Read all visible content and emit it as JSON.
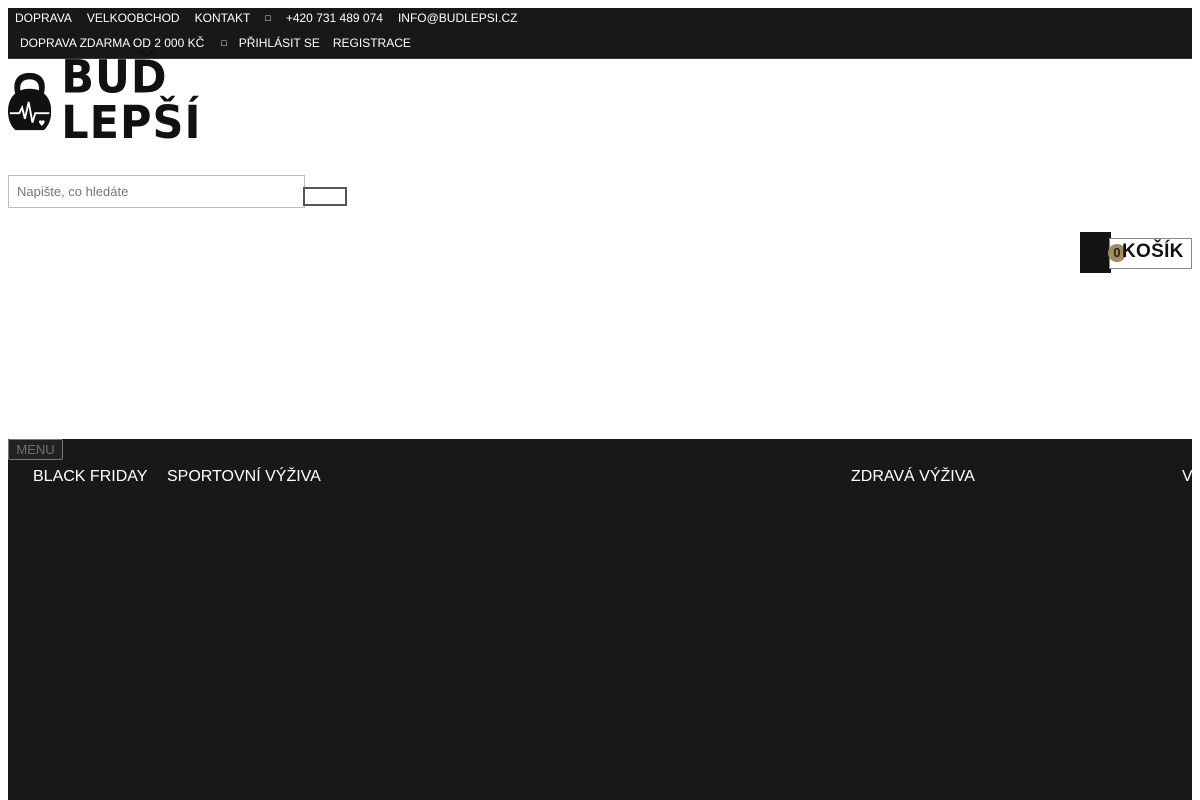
{
  "topbar": {
    "links": [
      "DOPRAVA",
      "VELKOOBCHOD",
      "KONTAKT"
    ],
    "phone_icon": "phone-icon",
    "phone": "+420 731 489 074",
    "email": "INFO@BUDLEPSI.CZ",
    "shipping_note": "DOPRAVA ZDARMA OD 2 000 KČ",
    "user_icon": "user-icon",
    "login": "PŘIHLÁSIT SE",
    "register": "REGISTRACE"
  },
  "logo": {
    "icon": "kettlebell-heartbeat-icon",
    "text": "BUĎ LEPŠÍ"
  },
  "search": {
    "placeholder": "Napište, co hledáte",
    "value": ""
  },
  "cart": {
    "count": "0",
    "label": "KOŠÍK"
  },
  "nav": {
    "menu_label": "MENU",
    "items": [
      "BLACK FRIDAY",
      "SPORTOVNÍ VÝŽIVA",
      "ZDRAVÁ VÝŽIVA",
      "V"
    ]
  },
  "colors": {
    "dark": "#181818",
    "accent": "#a68a5c"
  }
}
